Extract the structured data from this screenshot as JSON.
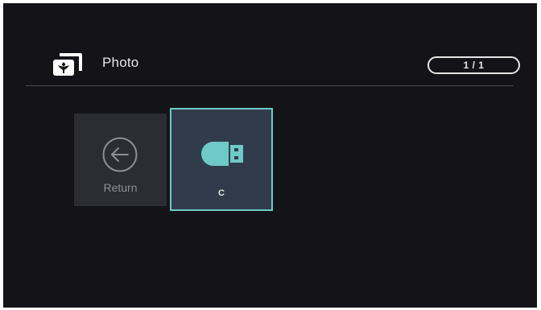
{
  "header": {
    "title": "Photo",
    "page_indicator": "1 / 1",
    "icon": "photo-gallery-icon"
  },
  "tiles": [
    {
      "label": "Return",
      "icon": "arrow-left-circle-icon"
    },
    {
      "label": "C",
      "icon": "usb-drive-icon",
      "selected": true
    }
  ],
  "colors": {
    "background": "#141418",
    "accent": "#6fc9c6",
    "selected_tile": "#303c4c",
    "tile": "#2c2d32",
    "text": "#e6e6e6",
    "muted_text": "#8e8f94"
  }
}
